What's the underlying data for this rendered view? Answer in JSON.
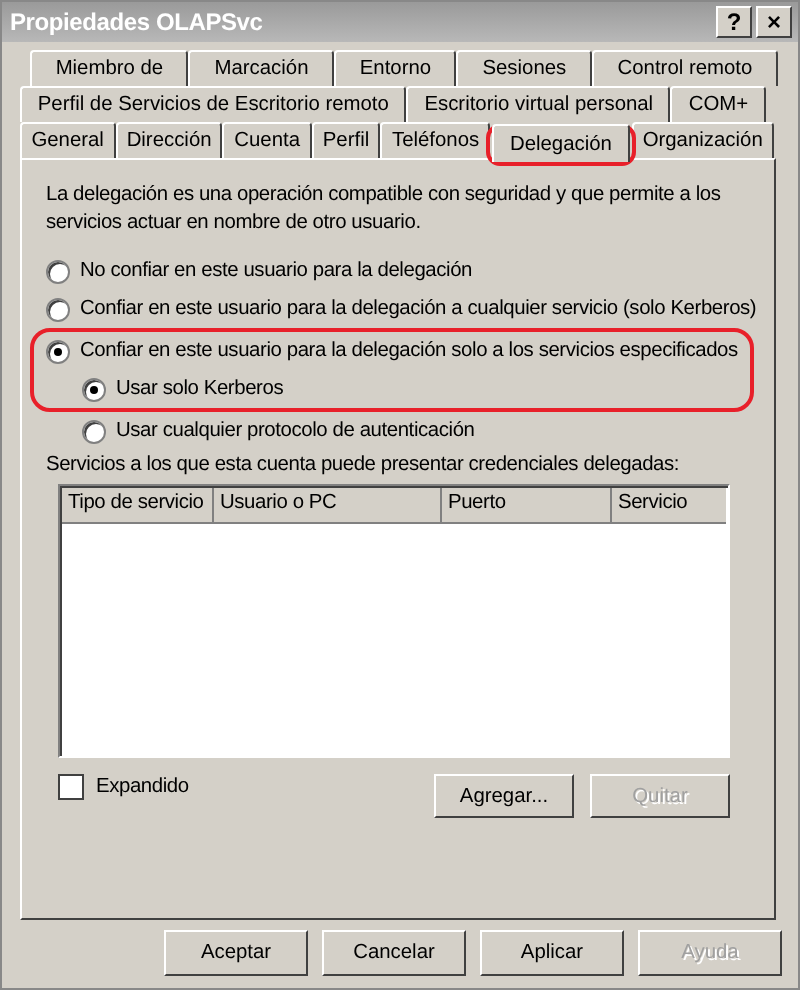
{
  "window": {
    "title": "Propiedades OLAPSvc",
    "help_button": "?",
    "close_button": "×"
  },
  "tab_rows": [
    {
      "tabs": [
        {
          "label": "Miembro de",
          "selected": false,
          "highlighted": false
        },
        {
          "label": "Marcación",
          "selected": false,
          "highlighted": false
        },
        {
          "label": "Entorno",
          "selected": false,
          "highlighted": false
        },
        {
          "label": "Sesiones",
          "selected": false,
          "highlighted": false
        },
        {
          "label": "Control remoto",
          "selected": false,
          "highlighted": false
        }
      ]
    },
    {
      "tabs": [
        {
          "label": "Perfil de Servicios de Escritorio remoto",
          "selected": false,
          "highlighted": false
        },
        {
          "label": "Escritorio virtual personal",
          "selected": false,
          "highlighted": false
        },
        {
          "label": "COM+",
          "selected": false,
          "highlighted": false
        }
      ]
    },
    {
      "tabs": [
        {
          "label": "General",
          "selected": false,
          "highlighted": false
        },
        {
          "label": "Dirección",
          "selected": false,
          "highlighted": false
        },
        {
          "label": "Cuenta",
          "selected": false,
          "highlighted": false
        },
        {
          "label": "Perfil",
          "selected": false,
          "highlighted": false
        },
        {
          "label": "Teléfonos",
          "selected": false,
          "highlighted": false
        },
        {
          "label": "Delegación",
          "selected": true,
          "highlighted": true
        },
        {
          "label": "Organización",
          "selected": false,
          "highlighted": false
        }
      ]
    }
  ],
  "description": "La delegación es una operación compatible con seguridad y que permite a los servicios actuar en nombre de otro usuario.",
  "options": [
    {
      "label": "No confiar en este usuario para la delegación",
      "selected": false,
      "highlighted": false
    },
    {
      "label": "Confiar en este usuario para la delegación a cualquier servicio (solo Kerberos)",
      "selected": false,
      "highlighted": false
    },
    {
      "label": "Confiar en este usuario para la delegación solo a los servicios especificados",
      "selected": true,
      "highlighted": true,
      "children": [
        {
          "label": "Usar solo Kerberos",
          "selected": true,
          "highlighted": true
        },
        {
          "label": "Usar cualquier protocolo de autenticación",
          "selected": false,
          "highlighted": false
        }
      ]
    }
  ],
  "services_label": "Servicios a los que esta cuenta puede presentar credenciales delegadas:",
  "table": {
    "columns": [
      "Tipo de servicio",
      "Usuario o PC",
      "Puerto",
      "Servicio"
    ]
  },
  "expanded_checkbox": {
    "label": "Expandido",
    "checked": false
  },
  "list_buttons": [
    {
      "label": "Agregar...",
      "disabled": false
    },
    {
      "label": "Quitar",
      "disabled": true
    }
  ],
  "buttons": [
    {
      "label": "Aceptar",
      "disabled": false
    },
    {
      "label": "Cancelar",
      "disabled": false
    },
    {
      "label": "Aplicar",
      "disabled": false
    },
    {
      "label": "Ayuda",
      "disabled": true
    }
  ]
}
